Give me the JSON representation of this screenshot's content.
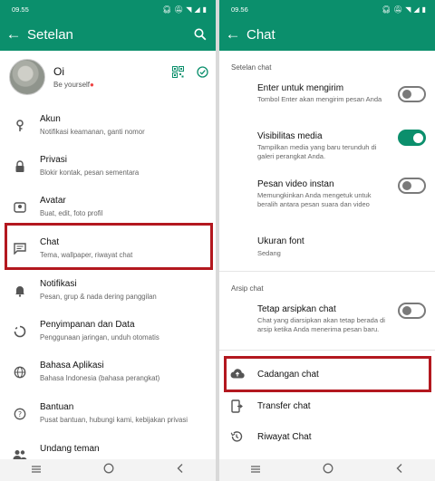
{
  "left": {
    "status_time": "09.55",
    "title": "Setelan",
    "profile": {
      "name": "Oi",
      "about": "Be yourself"
    },
    "items": [
      {
        "title": "Akun",
        "sub": "Notifikasi keamanan, ganti nomor",
        "icon": "key-icon"
      },
      {
        "title": "Privasi",
        "sub": "Blokir kontak, pesan sementara",
        "icon": "lock-icon"
      },
      {
        "title": "Avatar",
        "sub": "Buat, edit, foto profil",
        "icon": "avatar-icon"
      },
      {
        "title": "Chat",
        "sub": "Tema, wallpaper, riwayat chat",
        "icon": "chat-icon"
      },
      {
        "title": "Notifikasi",
        "sub": "Pesan, grup & nada dering panggilan",
        "icon": "bell-icon"
      },
      {
        "title": "Penyimpanan dan Data",
        "sub": "Penggunaan jaringan, unduh otomatis",
        "icon": "storage-icon"
      },
      {
        "title": "Bahasa Aplikasi",
        "sub": "Bahasa Indonesia (bahasa perangkat)",
        "icon": "globe-icon"
      },
      {
        "title": "Bantuan",
        "sub": "Pusat bantuan, hubungi kami, kebijakan privasi",
        "icon": "help-icon"
      },
      {
        "title": "Undang teman",
        "sub": "",
        "icon": "people-icon"
      }
    ]
  },
  "right": {
    "status_time": "09.56",
    "title": "Chat",
    "section_chat": "Setelan chat",
    "settings": [
      {
        "title": "Enter untuk mengirim",
        "sub": "Tombol Enter akan mengirim pesan Anda",
        "toggle": false
      },
      {
        "title": "Visibilitas media",
        "sub": "Tampilkan media yang baru terunduh di galeri perangkat Anda.",
        "toggle": true
      },
      {
        "title": "Pesan video instan",
        "sub": "Memungkinkan Anda mengetuk untuk beralih antara pesan suara dan video",
        "toggle": false
      },
      {
        "title": "Ukuran font",
        "sub": "Sedang"
      }
    ],
    "section_archive": "Arsip chat",
    "archive_setting": {
      "title": "Tetap arsipkan chat",
      "sub": "Chat yang diarsipkan akan tetap berada di arsip ketika Anda menerima pesan baru.",
      "toggle": false
    },
    "bottom_items": [
      {
        "title": "Cadangan chat",
        "icon": "cloud-upload-icon"
      },
      {
        "title": "Transfer chat",
        "icon": "transfer-phone-icon"
      },
      {
        "title": "Riwayat Chat",
        "icon": "history-icon"
      }
    ]
  },
  "colors": {
    "primary": "#0b8f6c",
    "highlight": "#b3181f"
  }
}
